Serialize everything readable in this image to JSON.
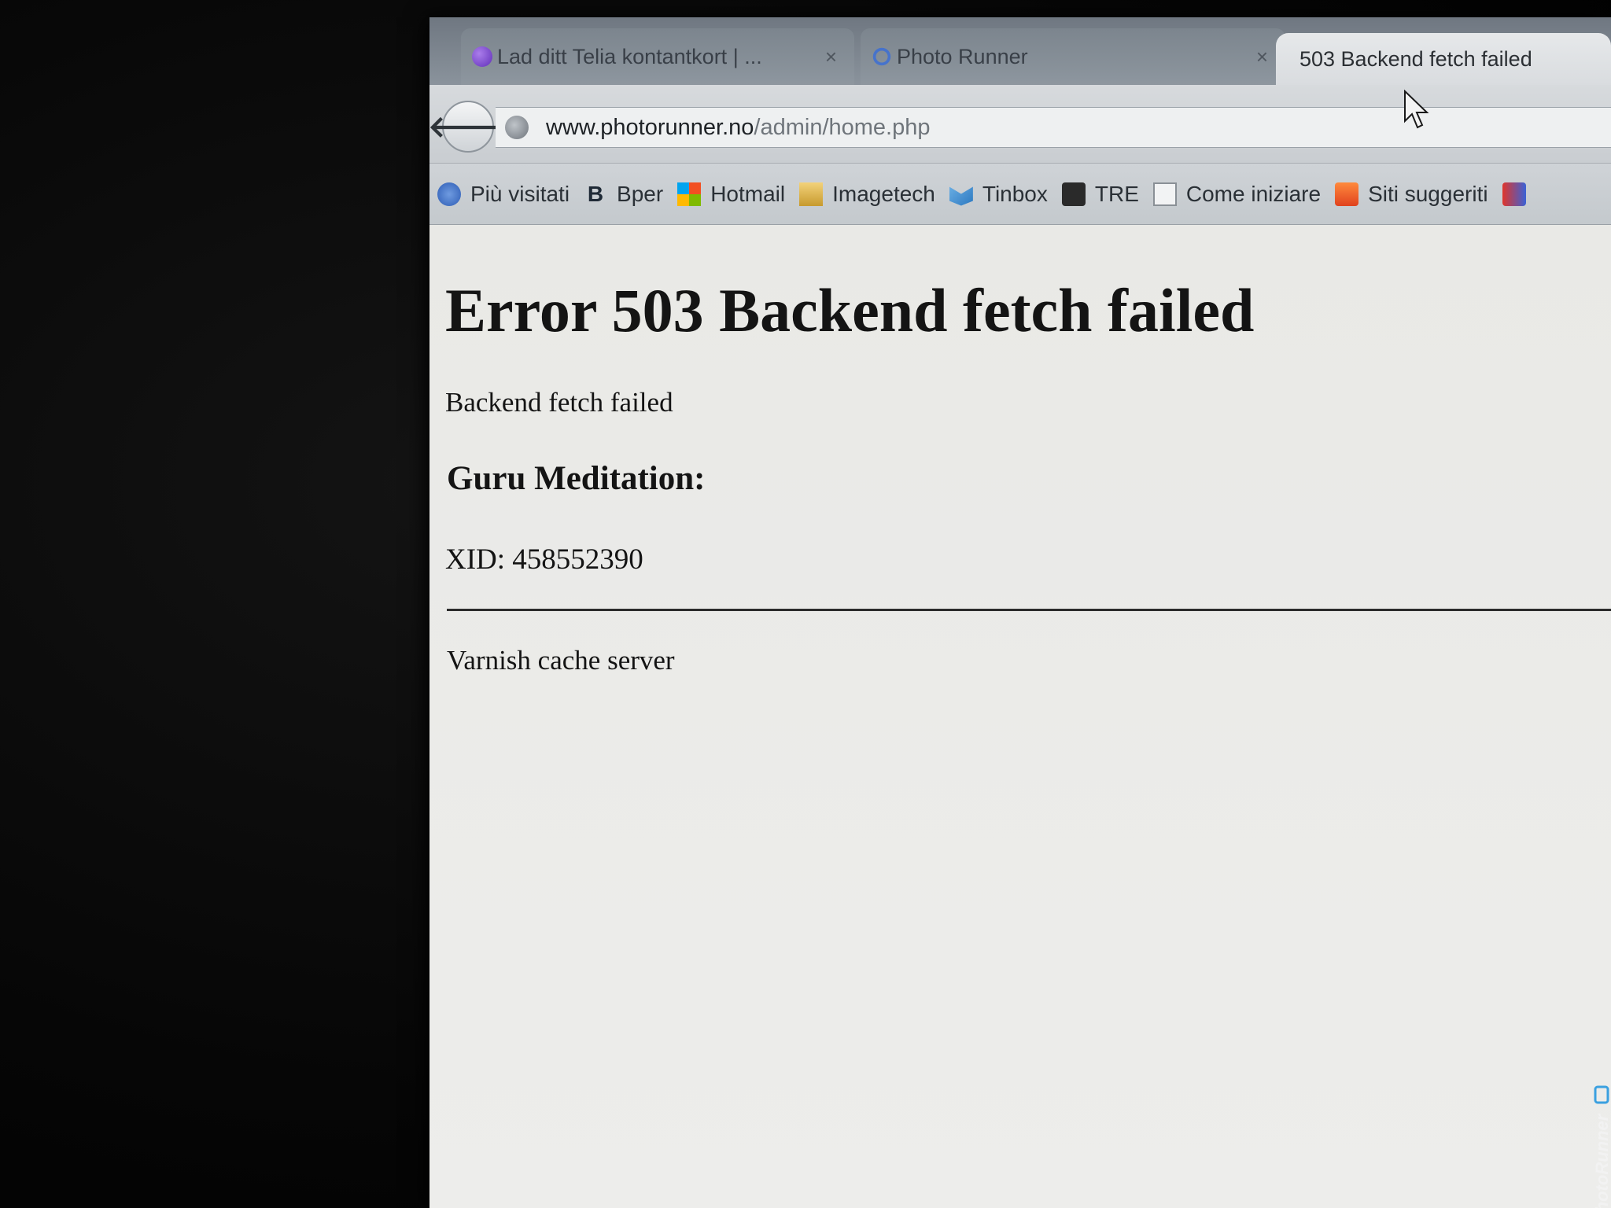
{
  "browser": {
    "tabs": [
      {
        "title": "Lad ditt Telia kontantkort | ...",
        "favicon": "telia-icon",
        "active": false
      },
      {
        "title": "Photo Runner",
        "favicon": "photorunner-icon",
        "active": false
      },
      {
        "title": "503 Backend fetch failed",
        "favicon": "",
        "active": true
      }
    ],
    "tab_close_glyph": "×",
    "url": {
      "domain": "www.photorunner.no",
      "path": "/admin/home.php"
    },
    "bookmarks": [
      {
        "label": "Più visitati",
        "icon": "most-visited-icon"
      },
      {
        "label": "Bper",
        "icon": "bper-icon",
        "glyph": "B"
      },
      {
        "label": "Hotmail",
        "icon": "hotmail-icon"
      },
      {
        "label": "Imagetech",
        "icon": "imagetech-icon"
      },
      {
        "label": "Tinbox",
        "icon": "tinbox-icon"
      },
      {
        "label": "TRE",
        "icon": "tre-icon"
      },
      {
        "label": "Come iniziare",
        "icon": "come-iniziare-icon"
      },
      {
        "label": "Siti suggeriti",
        "icon": "siti-suggeriti-icon"
      }
    ]
  },
  "page": {
    "title": "Error 503 Backend fetch failed",
    "message": "Backend fetch failed",
    "guru_heading": "Guru Meditation:",
    "xid": "XID: 458552390",
    "footer": "Varnish cache server"
  },
  "watermark": "PhotoRunner",
  "colors": {
    "page_background": "#ebebe8",
    "text": "#141414",
    "tab_strip": "#7a838c",
    "active_tab": "#e2e4e6"
  }
}
